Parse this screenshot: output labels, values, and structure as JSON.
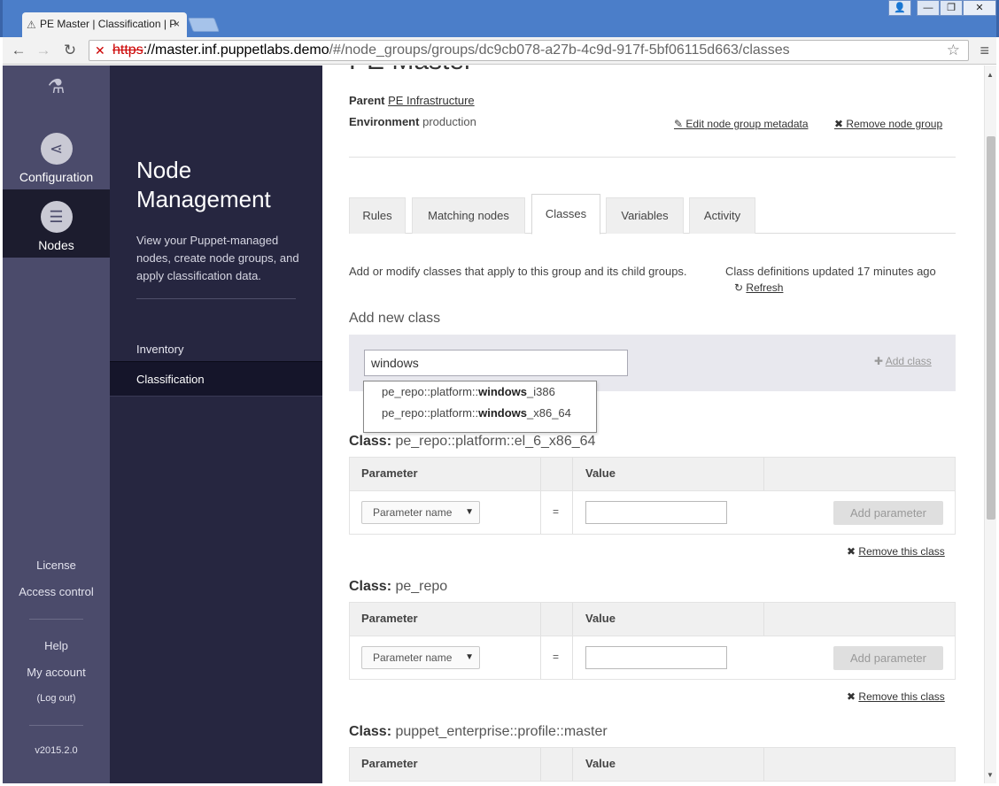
{
  "browser": {
    "tab_title": "PE Master | Classification | P",
    "tab_close": "×",
    "tab_icon": "puppet-icon",
    "window_buttons": [
      "👤",
      "—",
      "❐",
      "✕"
    ],
    "url_scheme": "https",
    "url_host": "://master.inf.puppetlabs.demo",
    "url_path": "/#/node_groups/groups/dc9cb078-a27b-4c9d-917f-5bf06115d663/classes"
  },
  "rail": {
    "items": [
      {
        "label": "Configuration",
        "icon": "share-icon",
        "active": false
      },
      {
        "label": "Nodes",
        "icon": "database-icon",
        "active": true
      }
    ],
    "footer": {
      "license": "License",
      "access_control": "Access control",
      "help": "Help",
      "my_account": "My account",
      "logout": "(Log out)",
      "version": "v2015.2.0"
    }
  },
  "subnav": {
    "title": "Node Management",
    "description": "View your Puppet-managed nodes, create node groups, and apply classification data.",
    "items": [
      {
        "label": "Inventory",
        "selected": false
      },
      {
        "label": "Classification",
        "selected": true
      }
    ]
  },
  "group": {
    "title": "PE Master",
    "parent_label": "Parent",
    "parent_value": "PE Infrastructure",
    "environment_label": "Environment",
    "environment_value": "production",
    "edit_metadata": "Edit node group metadata",
    "remove_group": "Remove node group"
  },
  "tabs": [
    {
      "label": "Rules",
      "active": false
    },
    {
      "label": "Matching nodes",
      "active": false
    },
    {
      "label": "Classes",
      "active": true
    },
    {
      "label": "Variables",
      "active": false
    },
    {
      "label": "Activity",
      "active": false
    }
  ],
  "classes_tab": {
    "description": "Add or modify classes that apply to this group and its child groups.",
    "updated_text": "Class definitions updated 17 minutes ago",
    "refresh_label": "Refresh",
    "add_new_class_title": "Add new class",
    "search_value": "windows",
    "add_class_label": "Add class",
    "suggestions": [
      {
        "prefix": "pe_repo::platform::",
        "match": "windows",
        "suffix": "_i386"
      },
      {
        "prefix": "pe_repo::platform::",
        "match": "windows",
        "suffix": "_x86_64"
      }
    ],
    "class_prefix": "Class:",
    "col_parameter": "Parameter",
    "col_value": "Value",
    "param_placeholder": "Parameter name",
    "equals": "=",
    "add_parameter": "Add parameter",
    "remove_class": "Remove this class",
    "classes": [
      {
        "name": "pe_repo::platform::el_6_x86_64"
      },
      {
        "name": "pe_repo"
      },
      {
        "name": "puppet_enterprise::profile::master"
      }
    ]
  }
}
